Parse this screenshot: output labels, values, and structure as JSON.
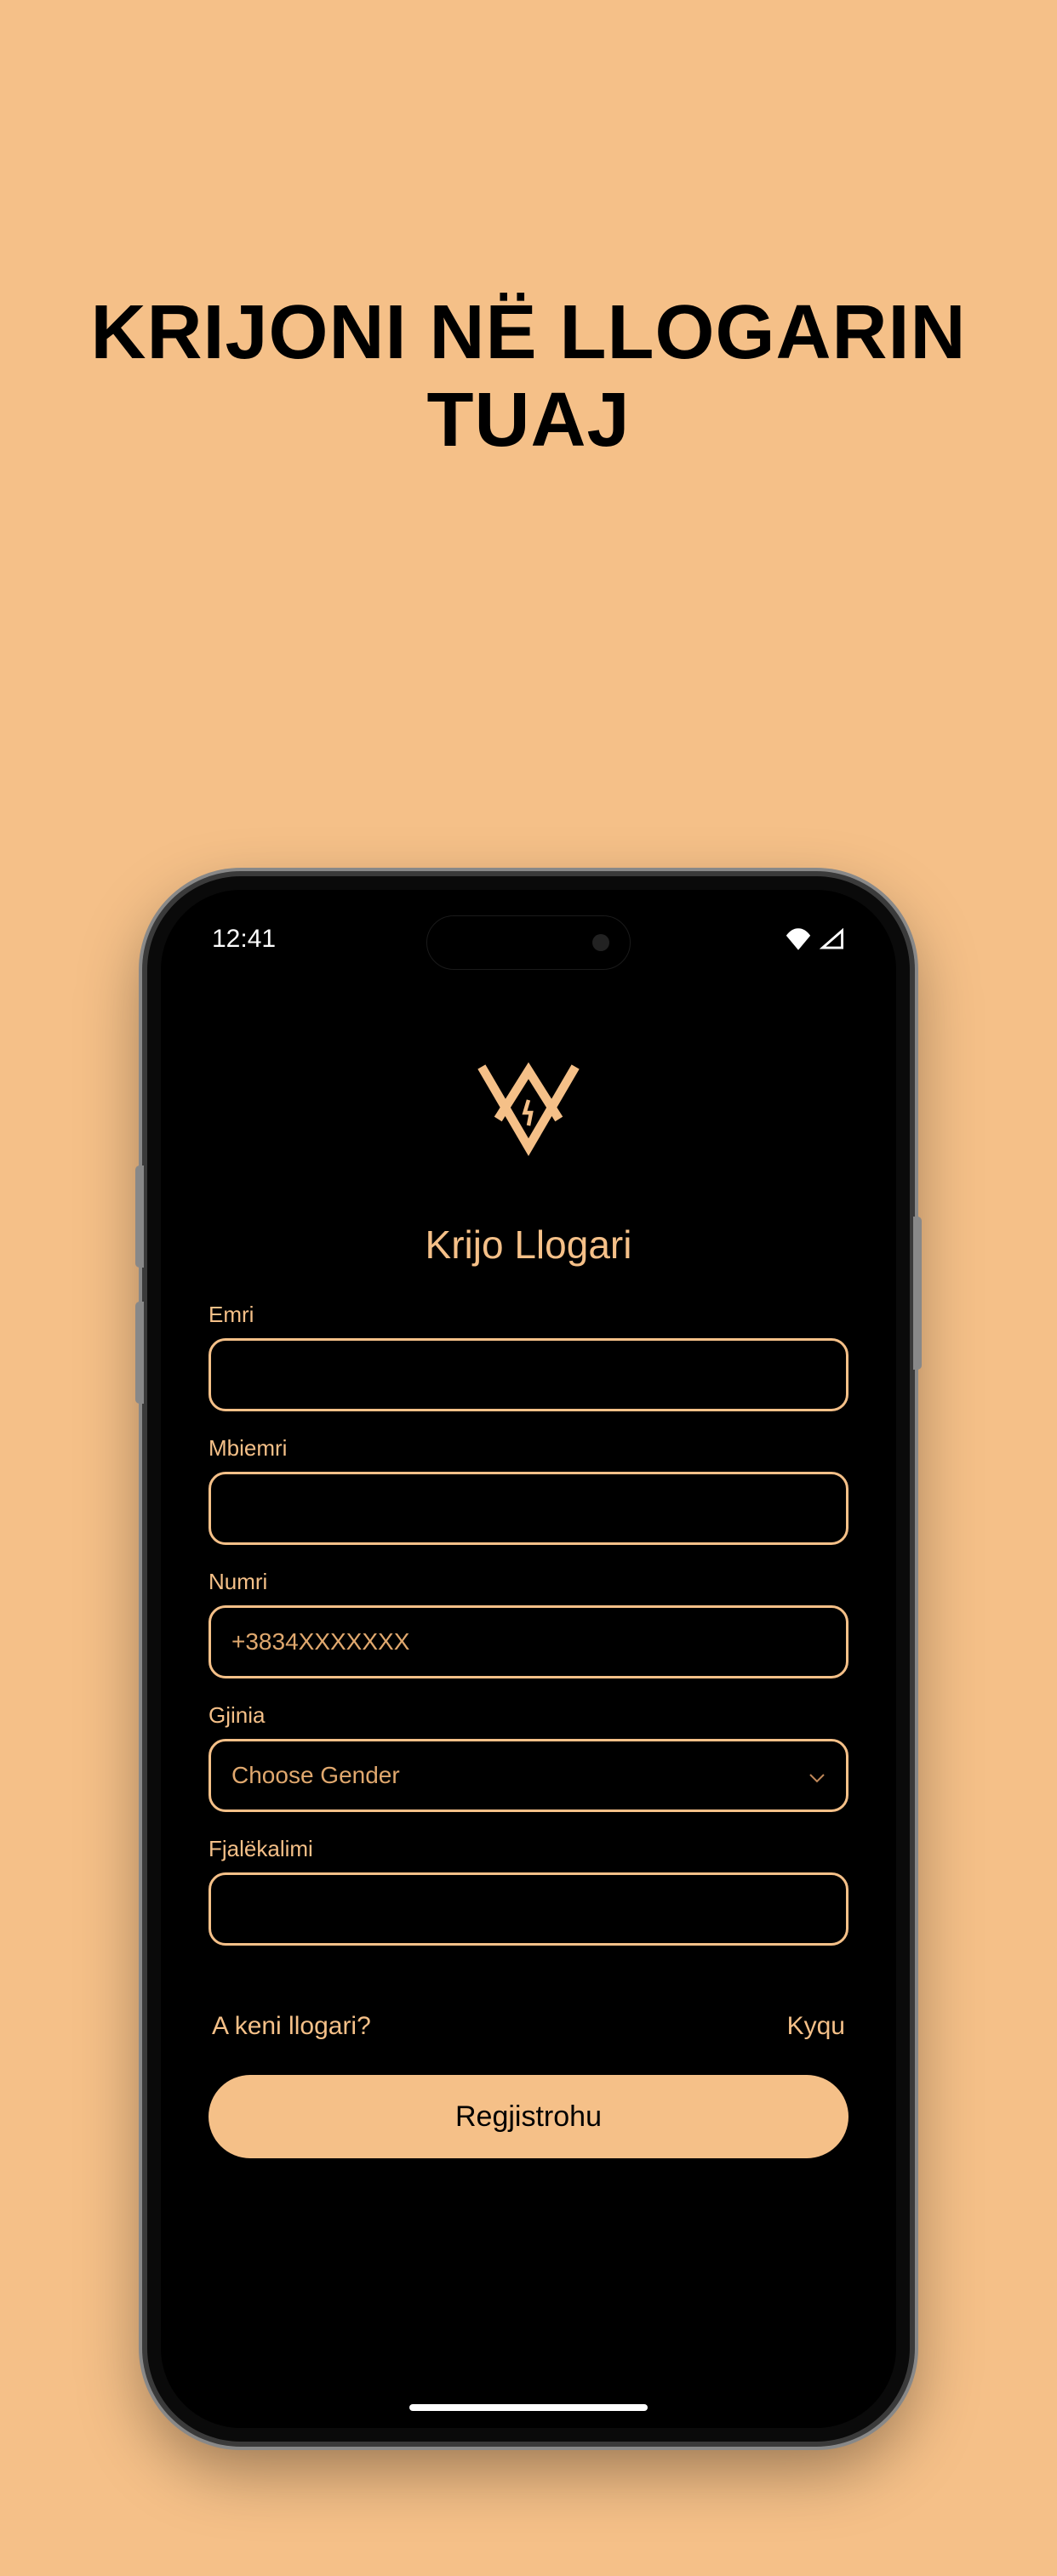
{
  "marketing": {
    "headline": "KRIJONI NË LLOGARIN TUAJ"
  },
  "status": {
    "time": "12:41"
  },
  "screen": {
    "title": "Krijo Llogari"
  },
  "form": {
    "first_name": {
      "label": "Emri",
      "value": ""
    },
    "last_name": {
      "label": "Mbiemri",
      "value": ""
    },
    "phone": {
      "label": "Numri",
      "placeholder": "+3834XXXXXXX",
      "value": ""
    },
    "gender": {
      "label": "Gjinia",
      "selected": "Choose Gender"
    },
    "password": {
      "label": "Fjalëkalimi",
      "value": ""
    }
  },
  "login": {
    "prompt": "A keni llogari?",
    "link": "Kyqu"
  },
  "actions": {
    "register": "Regjistrohu"
  },
  "colors": {
    "accent": "#f5c088",
    "background": "#000"
  }
}
